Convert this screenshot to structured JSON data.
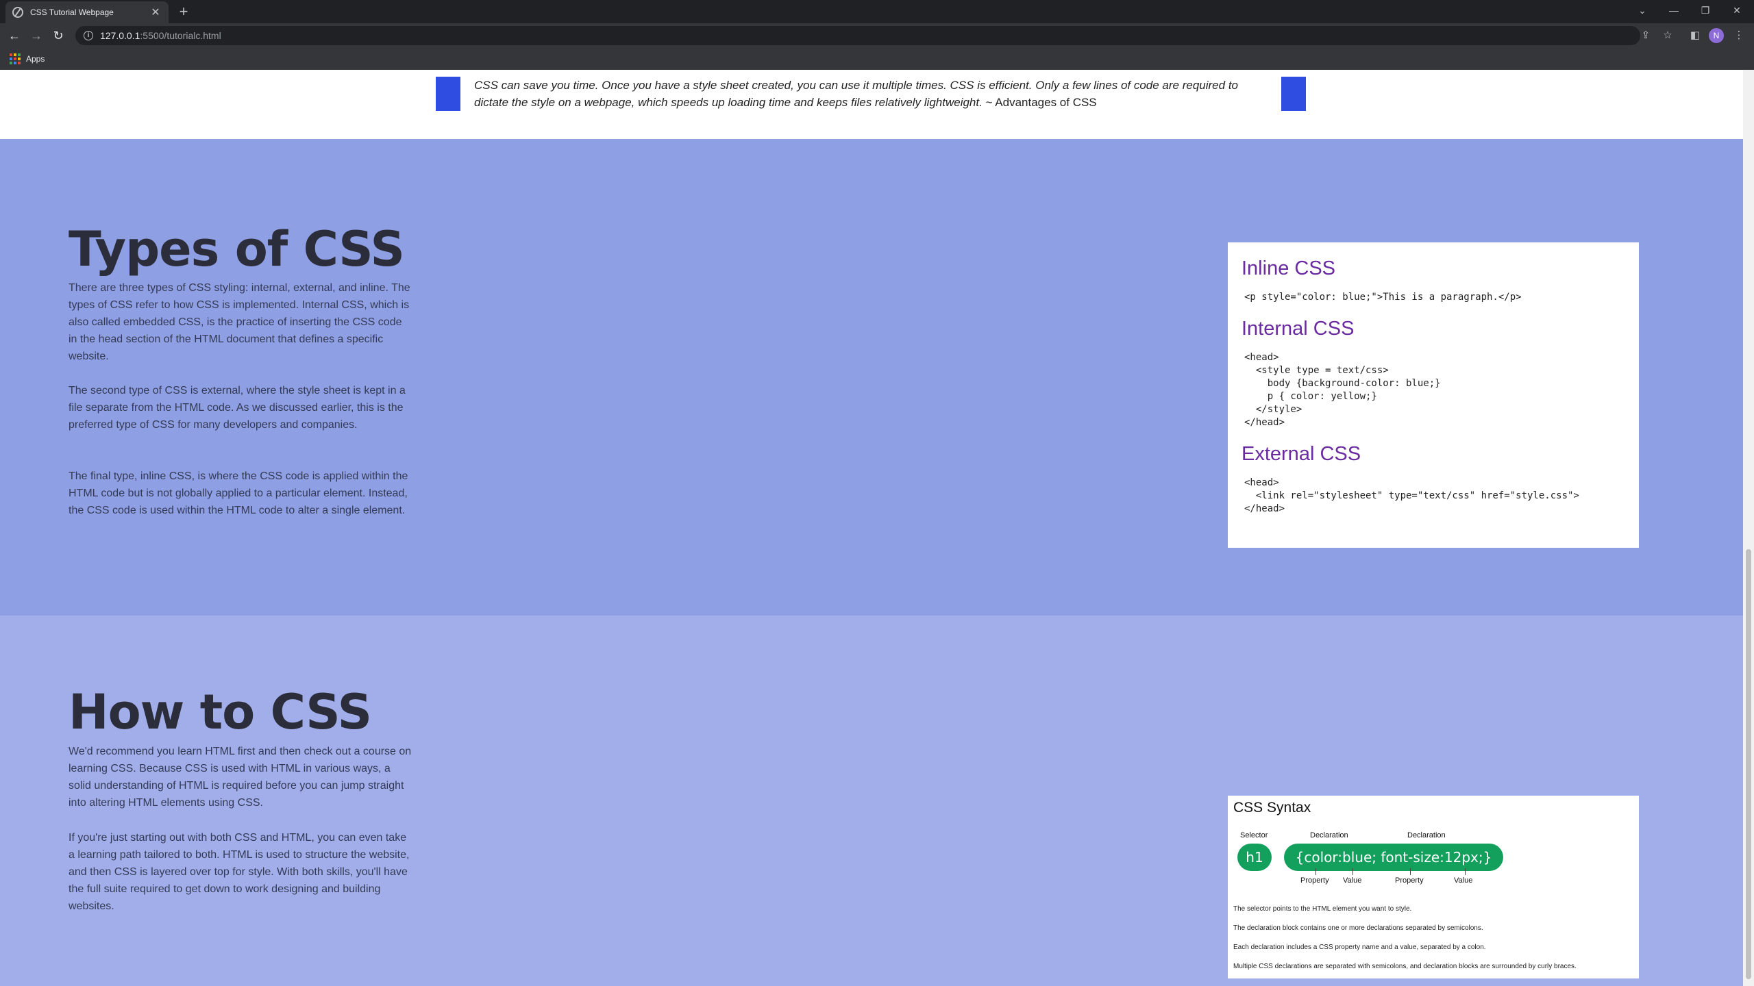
{
  "browser": {
    "tab_title": "CSS Tutorial Webpage",
    "url_host": "127.0.0.1",
    "url_path": ":5500/tutorialc.html",
    "bookmark_apps": "Apps",
    "avatar_letter": "N"
  },
  "quote": {
    "text": "CSS can save you time. Once you have a style sheet created, you can use it multiple times. CSS is efficient. Only a few lines of code are required to dictate the style on a webpage, which speeds up loading time and keeps files relatively lightweight.",
    "source": " ~ Advantages of CSS"
  },
  "types": {
    "title": "Types of CSS",
    "paragraphs": [
      "There are three types of CSS styling: internal, external, and inline. The types of CSS refer to how CSS is implemented. Internal CSS, which is also called embedded CSS, is the practice of inserting the CSS code in the head section of the HTML document that defines a specific website.",
      "The second type of CSS is external, where the style sheet is kept in a file separate from the HTML code. As we discussed earlier, this is the preferred type of CSS for many developers and companies.",
      "The final type, inline CSS, is where the CSS code is applied within the HTML code but is not globally applied to a particular element. Instead, the CSS code is used within the HTML code to alter a single element."
    ],
    "card": {
      "inline_heading": "Inline CSS",
      "inline_code": "<p style=\"color: blue;\">This is a paragraph.</p>",
      "internal_heading": "Internal CSS",
      "internal_code": "<head>\n  <style type = text/css>\n    body {background-color: blue;}\n    p { color: yellow;}\n  </style>\n</head>",
      "external_heading": "External CSS",
      "external_code": "<head>\n  <link rel=\"stylesheet\" type=\"text/css\" href=\"style.css\">\n</head>"
    }
  },
  "howto": {
    "title": "How to CSS",
    "paragraphs": [
      "We'd recommend you learn HTML first and then check out a course on learning CSS. Because CSS is used with HTML in various ways, a solid understanding of HTML is required before you can jump straight into altering HTML elements using CSS.",
      "If you're just starting out with both CSS and HTML, you can even take a learning path tailored to both. HTML is used to structure the website, and then CSS is layered over top for style. With both skills, you'll have the full suite required to get down to work designing and building websites."
    ],
    "syntax": {
      "title": "CSS Syntax",
      "selector_label": "Selector",
      "declaration_label": "Declaration",
      "selector": "h1",
      "declarations": "{color:blue; font-size:12px;}",
      "property_label": "Property",
      "value_label": "Value",
      "notes": [
        "The selector points to the HTML element you want to style.",
        "The declaration block contains one or more declarations separated by semicolons.",
        "Each declaration includes a CSS property name and a value, separated by a colon.",
        "Multiple CSS declarations are separated with semicolons, and declaration blocks are surrounded by curly braces."
      ]
    }
  },
  "colors": {
    "accent_blue": "#2f4de0",
    "types_bg": "#8f9fe3",
    "howto_bg": "#a2aeea",
    "heading_purple": "#6a2aa0",
    "syntax_green": "#12a05c"
  }
}
